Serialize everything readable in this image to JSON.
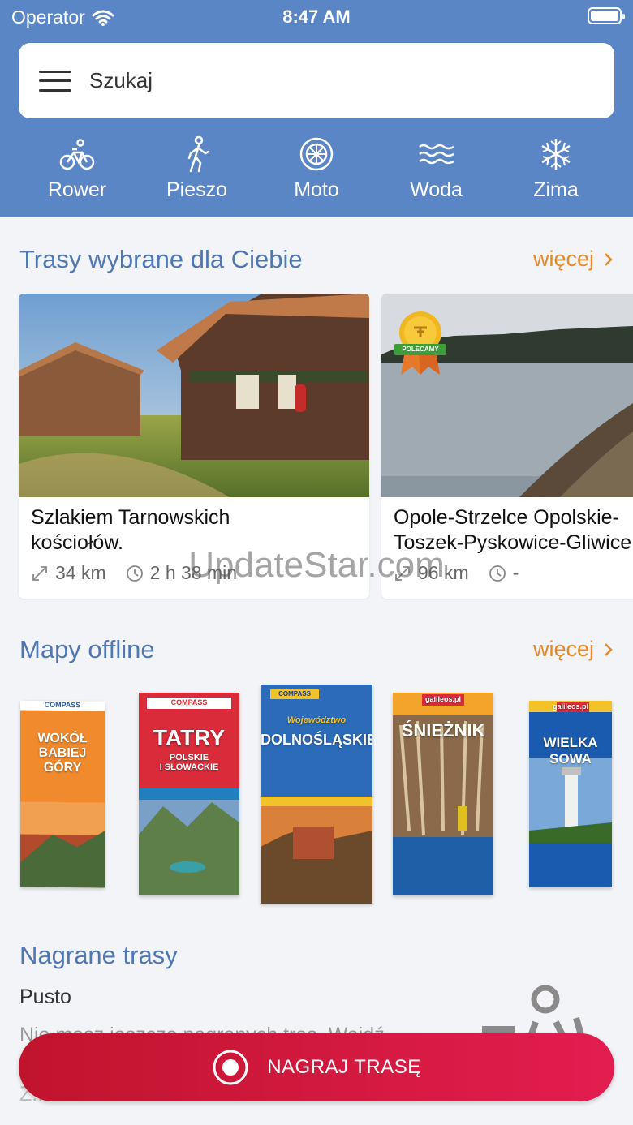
{
  "status_bar": {
    "carrier": "Operator",
    "time": "8:47 AM"
  },
  "search": {
    "placeholder": "Szukaj"
  },
  "categories": [
    {
      "label": "Rower",
      "icon": "bike-icon"
    },
    {
      "label": "Pieszo",
      "icon": "hiker-icon"
    },
    {
      "label": "Moto",
      "icon": "wheel-icon"
    },
    {
      "label": "Woda",
      "icon": "waves-icon"
    },
    {
      "label": "Zima",
      "icon": "snowflake-icon"
    }
  ],
  "routes_section": {
    "title": "Trasy wybrane dla Ciebie",
    "more": "więcej",
    "cards": [
      {
        "name": "Szlakiem Tarnowskich\nkościołów.",
        "distance": "34 km",
        "duration": "2 h 38 min"
      },
      {
        "name": "Opole-Strzelce Opolskie-\nToszek-Pyskowice-Gliwice",
        "distance": "96 km",
        "duration": "-",
        "badge": "POLECAMY"
      }
    ]
  },
  "maps_section": {
    "title": "Mapy offline",
    "more": "więcej",
    "maps": [
      {
        "brand": "COMPASS",
        "title": "WOKÓŁ\nBABIEJ GÓRY",
        "color": "#f08a2c"
      },
      {
        "brand": "COMPASS",
        "title": "TATRY",
        "subtitle": "POLSKIE\nI SŁOWACKIE",
        "color": "#d92b3a"
      },
      {
        "brand": "COMPASS",
        "subtitle": "Województwo",
        "title": "DOLNOŚLĄSKIE",
        "color": "#2c6bb8"
      },
      {
        "brand": "galileos.pl",
        "title": "ŚNIEŻNIK",
        "color": "#f2a52a"
      },
      {
        "brand": "galileos.pl",
        "title": "WIELKA SOWA",
        "color": "#1a5bb0"
      }
    ]
  },
  "recorded_section": {
    "title": "Nagrane trasy",
    "empty_label": "Pusto",
    "hint_text": "Nie masz jeszcze nagranych tras. Wejdź",
    "hint_text2": "Z..."
  },
  "record_button": {
    "label": "NAGRAJ TRASĘ"
  },
  "watermark": "UpdateStar.com",
  "colors": {
    "header": "#5b86c6",
    "accent": "#e58a2b",
    "title": "#4f77b3",
    "record": "#d3193f"
  }
}
